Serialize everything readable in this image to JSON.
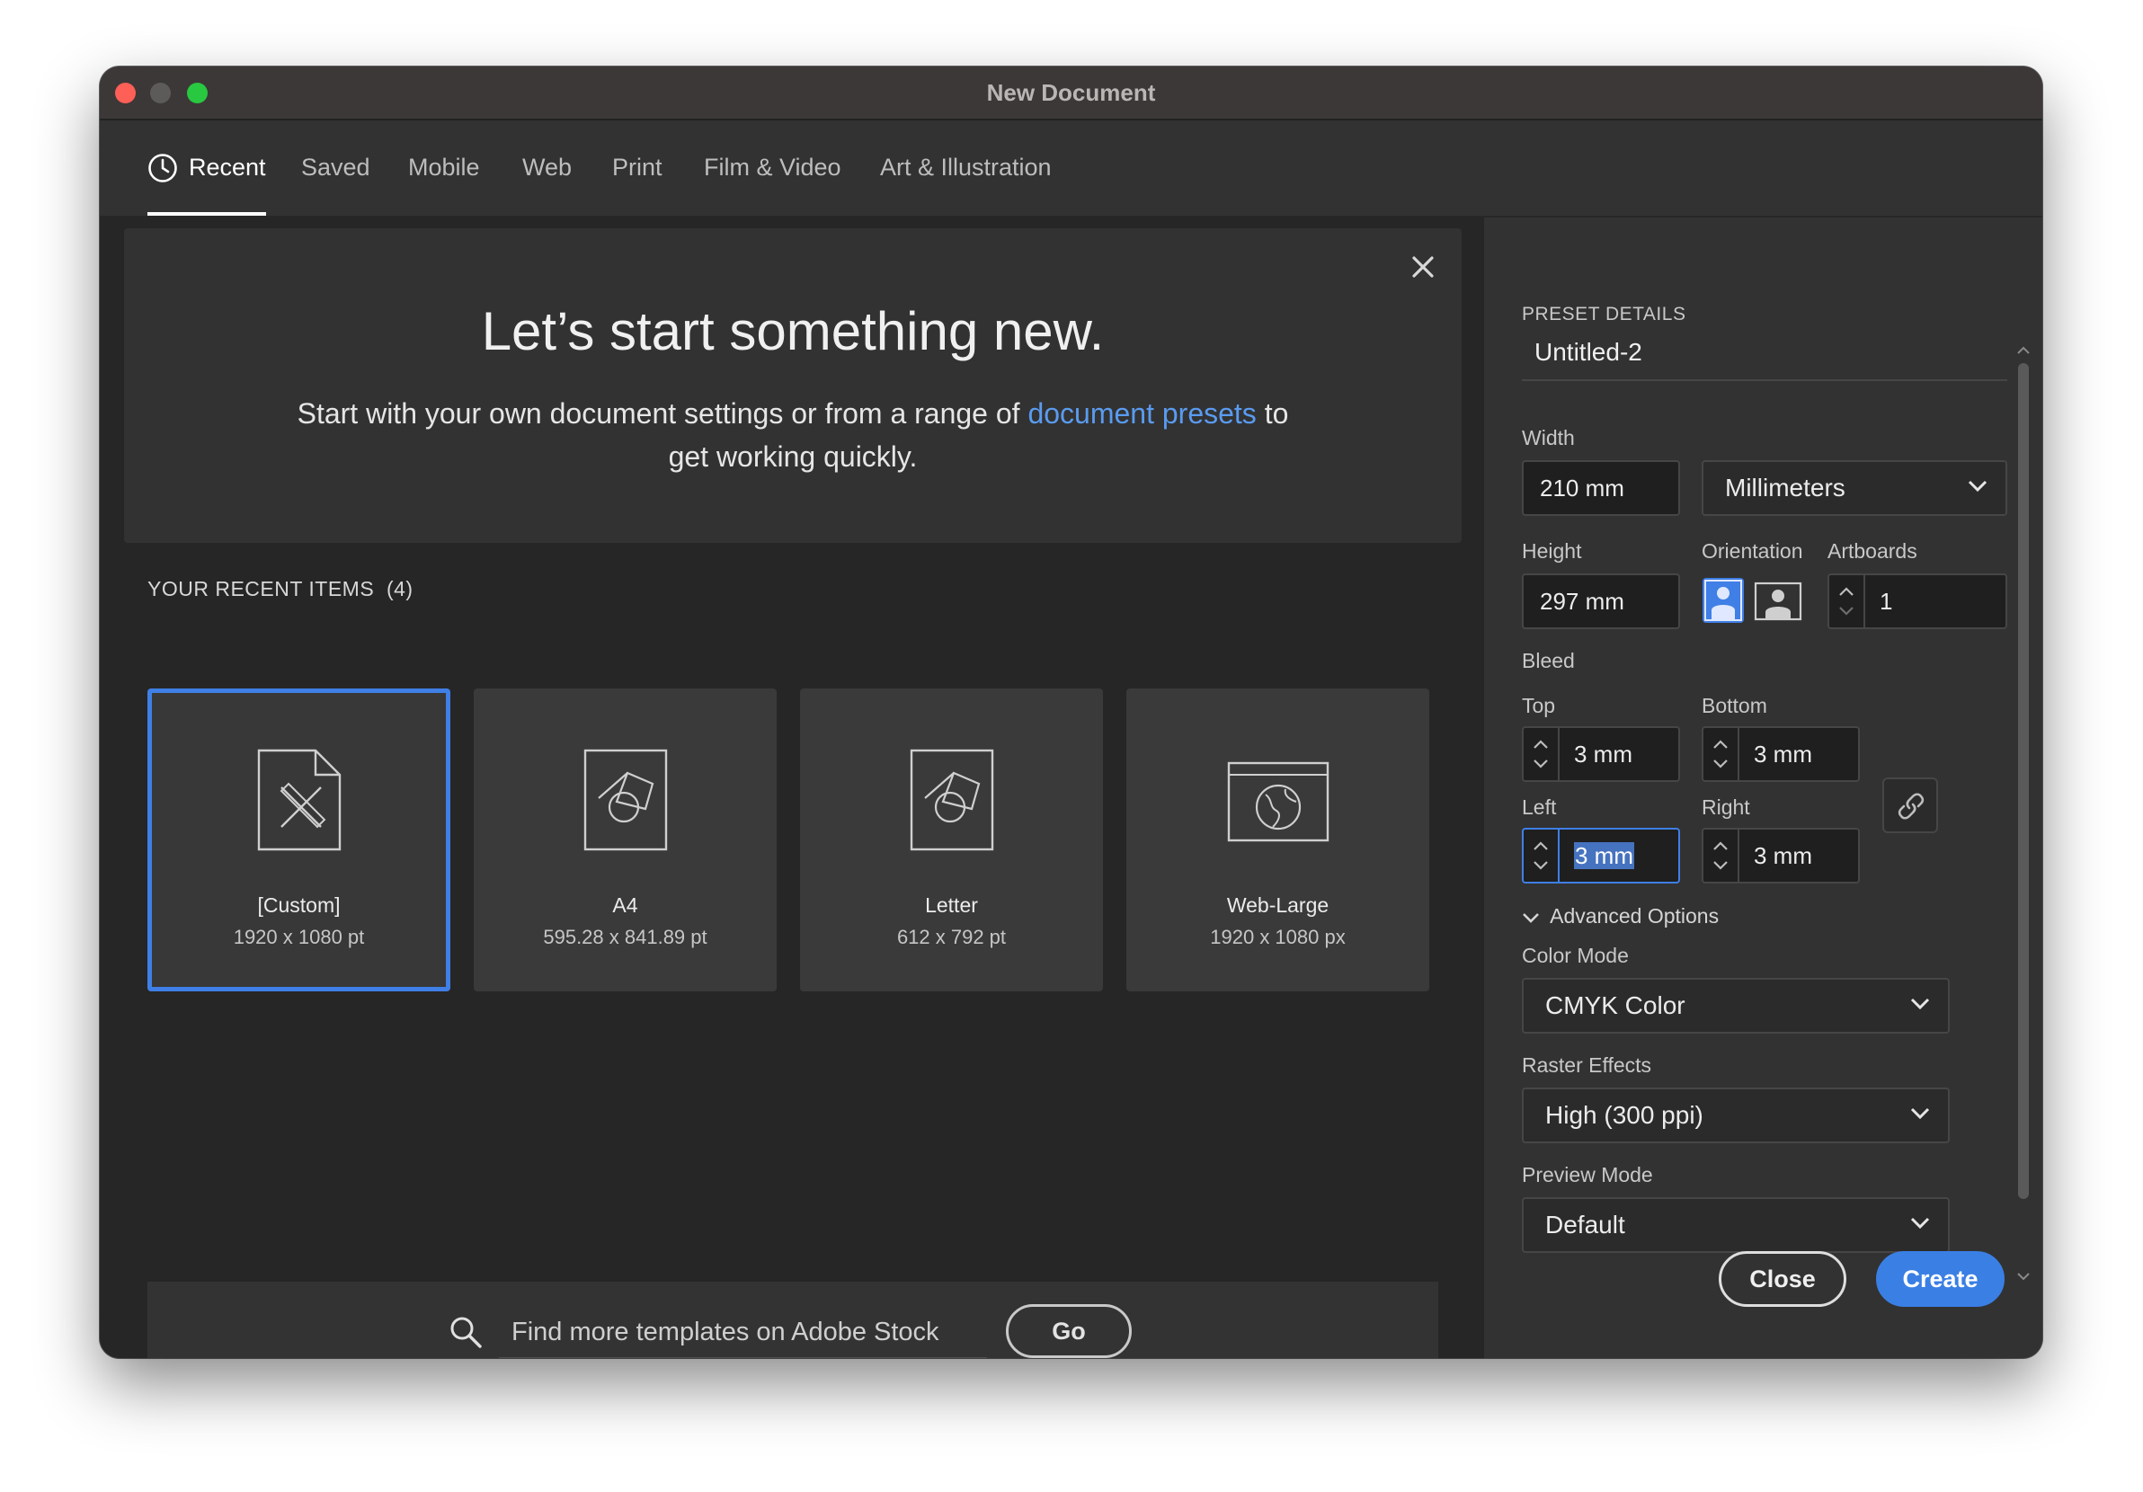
{
  "window": {
    "title": "New Document"
  },
  "tabs": [
    {
      "label": "Recent",
      "active": true,
      "icon": "clock-icon"
    },
    {
      "label": "Saved"
    },
    {
      "label": "Mobile"
    },
    {
      "label": "Web"
    },
    {
      "label": "Print"
    },
    {
      "label": "Film & Video"
    },
    {
      "label": "Art & Illustration"
    }
  ],
  "hero": {
    "title": "Let’s start something new.",
    "subtitle_before": "Start with your own document settings or from a range of ",
    "subtitle_link": "document presets",
    "subtitle_after": " to get working quickly."
  },
  "recent": {
    "label": "YOUR RECENT ITEMS",
    "count": "(4)",
    "items": [
      {
        "name": "[Custom]",
        "size": "1920 x 1080 pt",
        "icon": "custom-document-icon",
        "selected": true
      },
      {
        "name": "A4",
        "size": "595.28 x 841.89 pt",
        "icon": "print-document-icon"
      },
      {
        "name": "Letter",
        "size": "612 x 792 pt",
        "icon": "print-document-icon"
      },
      {
        "name": "Web-Large",
        "size": "1920 x 1080 px",
        "icon": "web-document-icon"
      }
    ]
  },
  "stock": {
    "placeholder": "Find more templates on Adobe Stock",
    "go_label": "Go"
  },
  "preset": {
    "section_label": "PRESET DETAILS",
    "name": "Untitled-2",
    "width_label": "Width",
    "width": "210 mm",
    "units": "Millimeters",
    "height_label": "Height",
    "height": "297 mm",
    "orientation_label": "Orientation",
    "artboards_label": "Artboards",
    "artboards": "1",
    "bleed_label": "Bleed",
    "top_label": "Top",
    "top": "3 mm",
    "bottom_label": "Bottom",
    "bottom": "3 mm",
    "left_label": "Left",
    "left": "3 mm",
    "right_label": "Right",
    "right": "3 mm",
    "advanced_label": "Advanced Options",
    "color_mode_label": "Color Mode",
    "color_mode": "CMYK Color",
    "raster_label": "Raster Effects",
    "raster": "High (300 ppi)",
    "preview_label": "Preview Mode",
    "preview": "Default"
  },
  "buttons": {
    "close": "Close",
    "create": "Create"
  },
  "colors": {
    "accent": "#3a7fe4",
    "link": "#5a9bf0",
    "background": "#323232"
  }
}
